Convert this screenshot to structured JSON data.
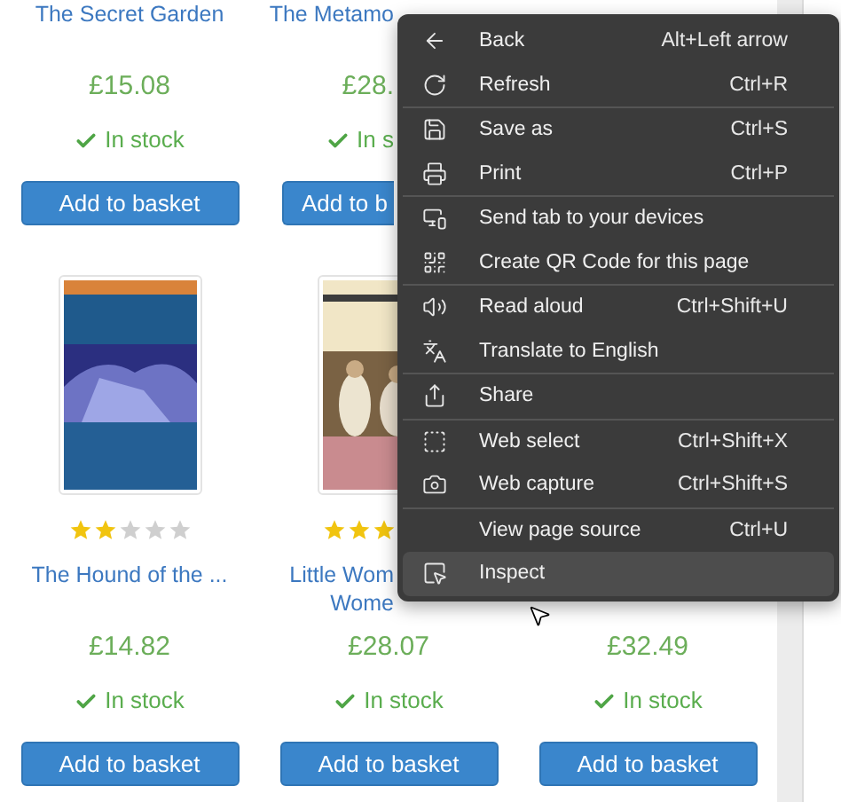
{
  "rows": [
    [
      {
        "title": "The Secret Garden",
        "price": "£15.08",
        "stock": "In stock",
        "button": "Add to basket"
      },
      {
        "title": "The Metamo",
        "price": "£28.",
        "stock": "In s",
        "button": "Add to b",
        "cut": true
      }
    ],
    [
      {
        "stars": 2,
        "title": "The Hound of the ...",
        "price": "£14.82",
        "stock": "In stock",
        "button": "Add to basket"
      },
      {
        "stars": 3,
        "title": "Little Wom\nWome",
        "price": "£28.07",
        "stock": "In stock",
        "button": "Add to basket",
        "cut": true
      },
      {
        "price": "£32.49",
        "stock": "In stock",
        "button": "Add to basket"
      }
    ]
  ],
  "context_menu": {
    "groups": [
      [
        {
          "label": "Back",
          "shortcut": "Alt+Left arrow",
          "selected": false
        },
        {
          "label": "Refresh",
          "shortcut": "Ctrl+R",
          "selected": false
        }
      ],
      [
        {
          "label": "Save as",
          "shortcut": "Ctrl+S",
          "selected": false
        },
        {
          "label": "Print",
          "shortcut": "Ctrl+P",
          "selected": false
        }
      ],
      [
        {
          "label": "Send tab to your devices",
          "selected": false
        },
        {
          "label": "Create QR Code for this page",
          "selected": false
        }
      ],
      [
        {
          "label": "Read aloud",
          "shortcut": "Ctrl+Shift+U",
          "selected": false
        },
        {
          "label": "Translate to English",
          "selected": false
        }
      ],
      [
        {
          "label": "Share",
          "selected": false
        }
      ],
      [
        {
          "label": "Web select",
          "shortcut": "Ctrl+Shift+X",
          "selected": false
        },
        {
          "label": "Web capture",
          "shortcut": "Ctrl+Shift+S",
          "selected": false
        }
      ],
      [
        {
          "label": "View page source",
          "shortcut": "Ctrl+U",
          "selected": false
        },
        {
          "label": "Inspect",
          "selected": true
        }
      ]
    ]
  }
}
